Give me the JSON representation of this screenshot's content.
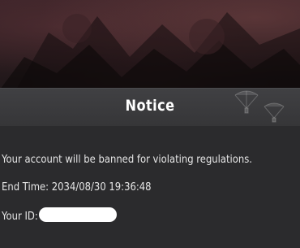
{
  "notice": {
    "title": "Notice",
    "message": "Your account will be banned for violating regulations.",
    "end_time_label": "End Time:",
    "end_time_value": "2034/08/30 19:36:48",
    "id_label": "Your ID:"
  },
  "icons": {
    "parachute": "parachute-icon"
  },
  "colors": {
    "background": "#1b1b1d",
    "dialog": "#2b2b2d",
    "title_bar": "#3c3c3f",
    "text": "#e6e6e6",
    "title_text": "#ffffff"
  }
}
